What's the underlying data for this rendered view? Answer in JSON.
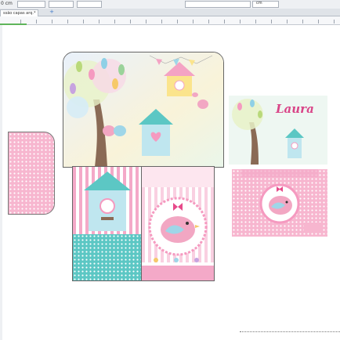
{
  "toolbar": {
    "unit_label": "0 cm",
    "unit_bottom": "cm"
  },
  "document": {
    "tab_label": "ssão capas arq.*",
    "add_tab": "+"
  },
  "artwork": {
    "name_script": "Laura"
  },
  "colors": {
    "pink": "#f4a9c8",
    "teal": "#5cc7c4",
    "sky": "#cfe7f6",
    "bird": "#f2a7c3"
  }
}
